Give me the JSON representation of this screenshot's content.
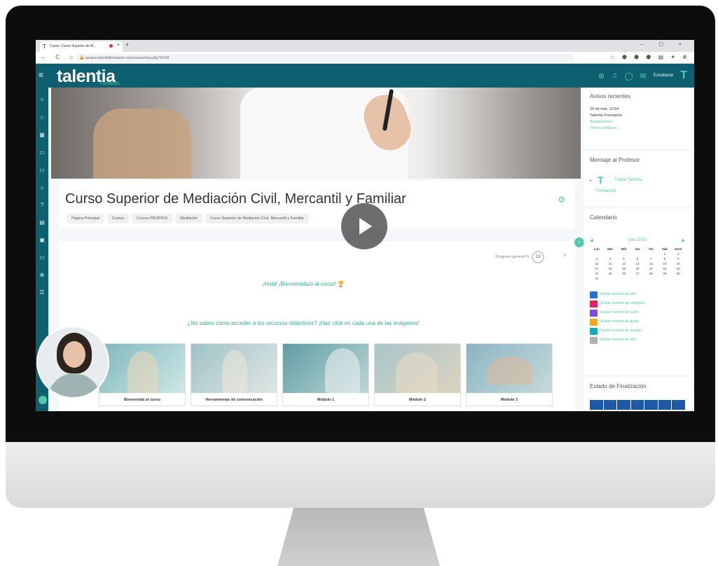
{
  "browser": {
    "tab_title": "Curso: Curso Superior de M...",
    "url": "campus.talentiaformacion.com/course/view.php?id=39",
    "new_tab_symbol": "+",
    "window_controls": "– ▢ ×",
    "nav_glyphs": "→ C ⌂",
    "ext_glyphs": "☆ ⬢ ⬢ ⬢ ▤ ✦ ⊕"
  },
  "header": {
    "logo_text": "talentia",
    "logo_sub": "Formación",
    "user_label": "Estudiante",
    "user_logo": "T",
    "icons": [
      "globe-icon",
      "bell-icon",
      "chat-icon",
      "mail-icon"
    ]
  },
  "sidebar": {
    "icons": [
      "home-icon",
      "star-icon",
      "calendar-icon",
      "folder-icon",
      "folder-icon",
      "graduation-icon",
      "help-icon",
      "list-icon",
      "book-icon",
      "folder-icon",
      "globe-icon",
      "menu-icon"
    ]
  },
  "course": {
    "title": "Curso Superior de Mediación Civil, Mercantil y Familiar",
    "breadcrumbs": [
      "Página Principal",
      "Cursos",
      "Cursos PROPIOS",
      "Mediación",
      "Curso Superior de Mediación Civil, Mercantil y Familiar"
    ],
    "progress_label": "Progreso general %",
    "progress_value": "13",
    "welcome": "¡Hola! ¡Bienvenida/o al curso! 🏆",
    "hint": "¿No sabes cómo acceder a los recursos didácticos? ¡Haz click en cada una de las imágenes!",
    "tiles": [
      {
        "label": "Bienvenida al curso"
      },
      {
        "label": "Herramientas de comunicación"
      },
      {
        "label": "Módulo 1"
      },
      {
        "label": "Módulo 2"
      },
      {
        "label": "Módulo 3"
      }
    ]
  },
  "blocks": {
    "announcements": {
      "title": "Avisos recientes",
      "date": "24 de ene, 10:54",
      "author": "Talentia Formación",
      "item": "Actualización",
      "older": "Temas antiguos ..."
    },
    "teacher_message": {
      "title": "Mensaje al Profesor",
      "tutor": "Tutora Talentia",
      "tutor2": "Formación"
    },
    "calendar": {
      "title": "Calendario",
      "month": "julio 2023",
      "days": [
        "Lun",
        "Mar",
        "Mié",
        "Jue",
        "Vie",
        "Sáb",
        "Dom"
      ],
      "dates": [
        "",
        "",
        "",
        "",
        "",
        "1",
        "2",
        "3",
        "4",
        "5",
        "6",
        "7",
        "8",
        "9",
        "10",
        "11",
        "12",
        "13",
        "14",
        "15",
        "16",
        "17",
        "18",
        "19",
        "20",
        "21",
        "22",
        "23",
        "24",
        "25",
        "26",
        "27",
        "28",
        "29",
        "30",
        "31"
      ],
      "events": [
        {
          "label": "Ocultar eventos de sitio",
          "color": "#2e6fd0"
        },
        {
          "label": "Ocultar eventos de categoría",
          "color": "#e0245e"
        },
        {
          "label": "Ocultar eventos de curso",
          "color": "#7a4ddb"
        },
        {
          "label": "Ocultar eventos de grupo",
          "color": "#f5a623"
        },
        {
          "label": "Ocultar eventos de usuario",
          "color": "#18a8b9"
        },
        {
          "label": "Ocultar eventos de otro",
          "color": "#b0b0b0"
        }
      ]
    },
    "completion": {
      "title": "Estado de Finalización"
    }
  },
  "colors": {
    "brand": "#0e5f6f",
    "accent": "#53c7a8"
  }
}
